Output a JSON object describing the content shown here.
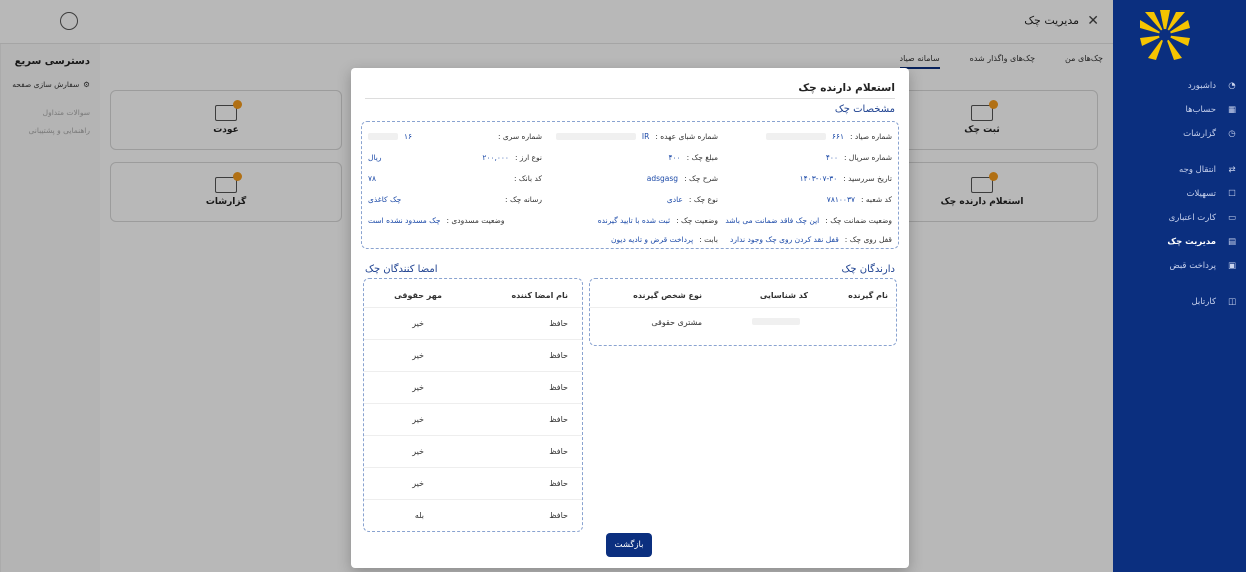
{
  "topbar": {
    "title": "مدیریت چک",
    "close_icon": "close-icon",
    "user_icon": "user-icon"
  },
  "quick": {
    "title": "دسترسی سریع",
    "customize": "سفارش سازی صفحه",
    "faq": "سوالات متداول",
    "support": "راهنمایی و پشتیبانی"
  },
  "sidebar": {
    "items": [
      {
        "label": "داشبورد",
        "icon": "dashboard-icon"
      },
      {
        "label": "حساب‌ها",
        "icon": "accounts-icon"
      },
      {
        "label": "گزارشات",
        "icon": "reports-icon"
      },
      {
        "label": "انتقال وجه",
        "icon": "transfer-icon"
      },
      {
        "label": "تسهیلات",
        "icon": "facilities-icon"
      },
      {
        "label": "کارت اعتباری",
        "icon": "credit-card-icon"
      },
      {
        "label": "مدیریت چک",
        "icon": "cheque-icon"
      },
      {
        "label": "پرداخت قبض",
        "icon": "bill-icon"
      },
      {
        "label": "کارتابل",
        "icon": "cartable-icon"
      }
    ],
    "active": "مدیریت چک"
  },
  "main": {
    "tabs": [
      "چک‌های من",
      "چک‌های واگذار شده",
      "سامانه صیاد"
    ],
    "cards": [
      "ثبت چک",
      "عودت",
      "استعلام دارنده چک",
      "گزارشات"
    ]
  },
  "modal": {
    "title": "استعلام دارنده چک",
    "details_title": "مشخصات چک",
    "fields": {
      "sayad_label": "شماره صیاد :",
      "sayad_value": "۶۶۱",
      "sheba_label": "شماره شبای عهده :",
      "sheba_value": "IR",
      "series_label": "شماره سری :",
      "series_value": "",
      "extra_value": "۱۶",
      "serial_label": "شماره سریال :",
      "serial_value": "۴۰۰",
      "amount_label": "مبلغ چک :",
      "amount_value": "۴۰۰",
      "currency_label": "نوع ارز :",
      "currency_value": "ریال",
      "due_label": "تاریخ سررسید :",
      "due_value": "۱۴۰۳-۰۷-۳۰",
      "desc_label": "شرح چک :",
      "desc_value": "۲۰۰,۰۰۰",
      "bank_label": "کد بانک :",
      "bank_value": "adsgasg",
      "branch_label": "کد شعبه :",
      "branch_value": "۷۸۱۰۰۳۷",
      "type_label": "نوع چک :",
      "type_value": "عادی",
      "media_label": "رسانه چک :",
      "media_value": "۷۸",
      "media_text": "چک کاغذی",
      "guarantee_label": "وضعیت ضمانت چک :",
      "guarantee_value": "این چک فاقد ضمانت می باشد",
      "status_label": "وضعیت چک :",
      "status_value": "ثبت شده با تایید گیرنده",
      "block_label": "وضعیت مسدودی :",
      "block_value": "چک مسدود نشده است",
      "lock_label": "قفل روی چک :",
      "lock_value": "قفل نقد کردن روی چک وجود ندارد",
      "reason_label": "بابت :",
      "reason_value": "پرداخت قرض و تادیه دیون"
    },
    "holders_title": "دارندگان چک",
    "holders_headers": [
      "نام گیرنده",
      "کد شناسایی",
      "نوع شخص گیرنده"
    ],
    "holders_rows": [
      {
        "name": "",
        "id": "",
        "type": "مشتری حقوقی"
      }
    ],
    "signers_title": "امضا کنندگان چک",
    "signers_headers": [
      "نام امضا کننده",
      "مهر حقوقی"
    ],
    "signers_rows": [
      {
        "name": "حافظ",
        "seal": "خیر"
      },
      {
        "name": "حافظ",
        "seal": "خیر"
      },
      {
        "name": "حافظ",
        "seal": "خیر"
      },
      {
        "name": "حافظ",
        "seal": "خیر"
      },
      {
        "name": "حافظ",
        "seal": "خیر"
      },
      {
        "name": "حافظ",
        "seal": "خیر"
      },
      {
        "name": "حافظ",
        "seal": "بله"
      }
    ],
    "back_button": "بازگشت"
  }
}
